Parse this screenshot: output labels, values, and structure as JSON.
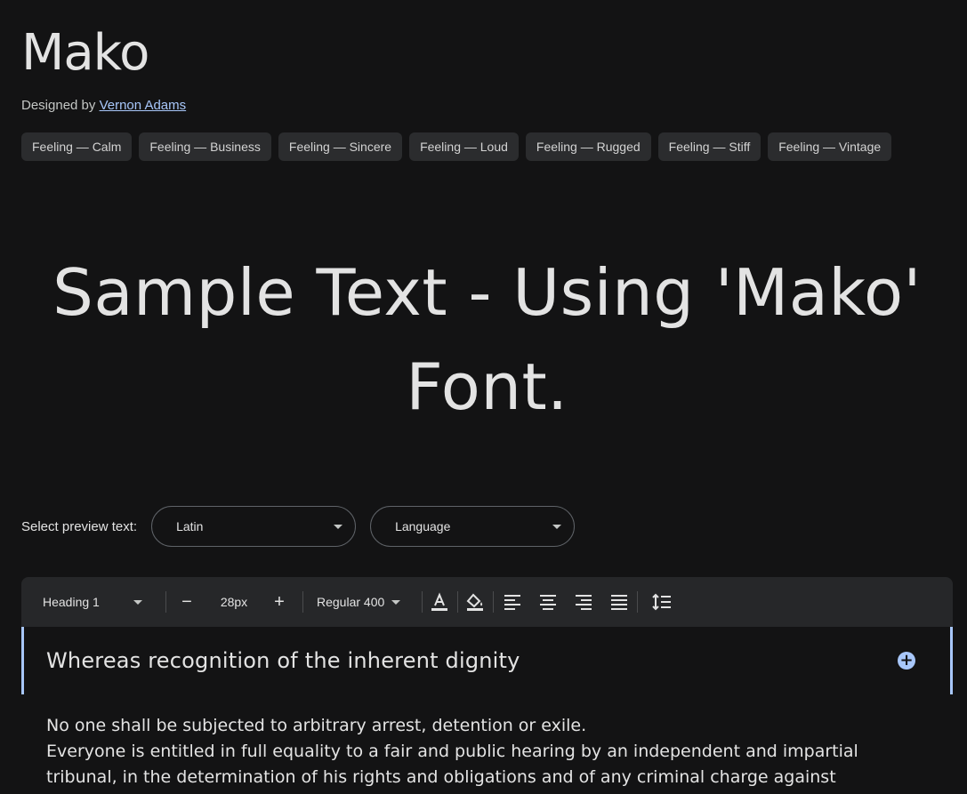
{
  "font": {
    "name": "Mako",
    "designed_by_prefix": "Designed by",
    "designer": "Vernon Adams"
  },
  "tags": [
    "Feeling — Calm",
    "Feeling — Business",
    "Feeling — Sincere",
    "Feeling — Loud",
    "Feeling — Rugged",
    "Feeling — Stiff",
    "Feeling — Vintage"
  ],
  "preview": {
    "text": "Sample Text - Using 'Mako' Font."
  },
  "selector": {
    "label": "Select preview text:",
    "script_value": "Latin",
    "language_value": "Language"
  },
  "toolbar": {
    "style_value": "Heading 1",
    "decrease_label": "−",
    "size_value": "28px",
    "increase_label": "+",
    "weight_value": "Regular 400"
  },
  "editor": {
    "heading": "Whereas recognition of the inherent dignity",
    "paragraph_1": "No one shall be subjected to arbitrary arrest, detention or exile.",
    "paragraph_2": "Everyone is entitled in full equality to a fair and public hearing by an independent and impartial tribunal, in the determination of his rights and obligations and of any criminal charge against"
  },
  "colors": {
    "background": "#131314",
    "accent": "#a8c7fa",
    "chip": "#2b2c2e",
    "toolbar": "#262729"
  },
  "icons": {
    "text_color": "text-color-icon",
    "fill_color": "fill-color-icon",
    "align_left": "align-left-icon",
    "align_center": "align-center-icon",
    "align_right": "align-right-icon",
    "align_justify": "align-justify-icon",
    "line_height": "line-height-icon",
    "add": "add-circle-icon"
  }
}
